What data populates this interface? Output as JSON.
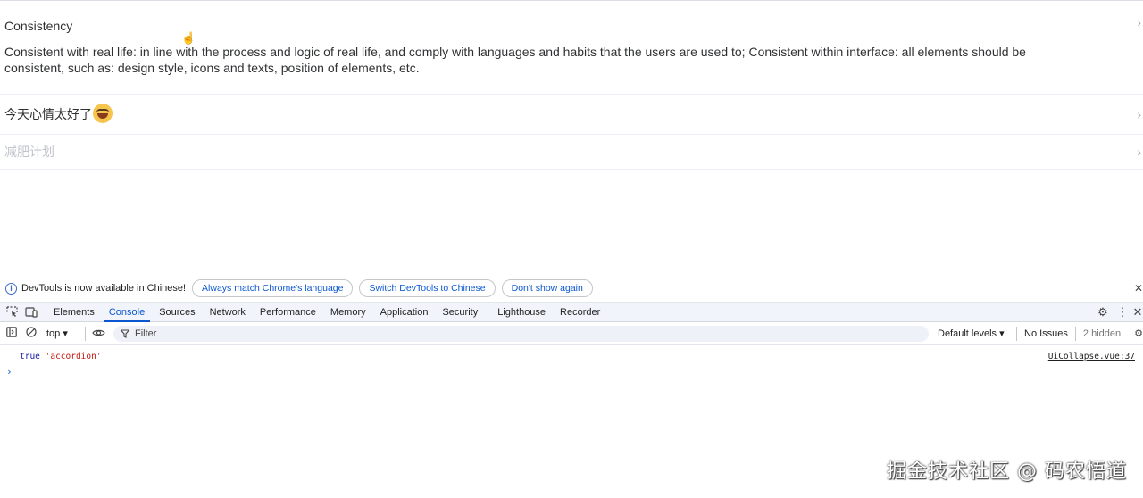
{
  "collapse": {
    "items": [
      {
        "title": "Consistency",
        "content": "Consistent with real life: in line with the process and logic of real life, and comply with languages and habits that the users are used to; Consistent within interface: all elements should be consistent, such as: design style, icons and texts, position of elements, etc.",
        "expanded": true,
        "disabled": false
      },
      {
        "title": "今天心情太好了",
        "icon": "laughing-emoji-icon",
        "expanded": false,
        "disabled": false
      },
      {
        "title": "减肥计划",
        "expanded": false,
        "disabled": true
      }
    ],
    "arrow_glyph": "›"
  },
  "devtools": {
    "infobar": {
      "message": "DevTools is now available in Chinese!",
      "buttons": [
        "Always match Chrome's language",
        "Switch DevTools to Chinese",
        "Don't show again"
      ],
      "close_glyph": "✕"
    },
    "tabs": [
      "Elements",
      "Console",
      "Sources",
      "Network",
      "Performance",
      "Memory",
      "Application",
      "Security",
      "Lighthouse",
      "Recorder"
    ],
    "active_tab": "Console",
    "toolbar": {
      "context": "top ▾",
      "filter_placeholder": "Filter",
      "levels": "Default levels ▾",
      "issues": "No Issues",
      "hidden": "2 hidden"
    },
    "console": {
      "log": {
        "bool": "true",
        "str": "'accordion'"
      },
      "source": "UiCollapse.vue:37",
      "prompt": "›"
    },
    "accent_color": "#0b57d0"
  },
  "watermark": "掘金技术社区 @ 码农悟道"
}
